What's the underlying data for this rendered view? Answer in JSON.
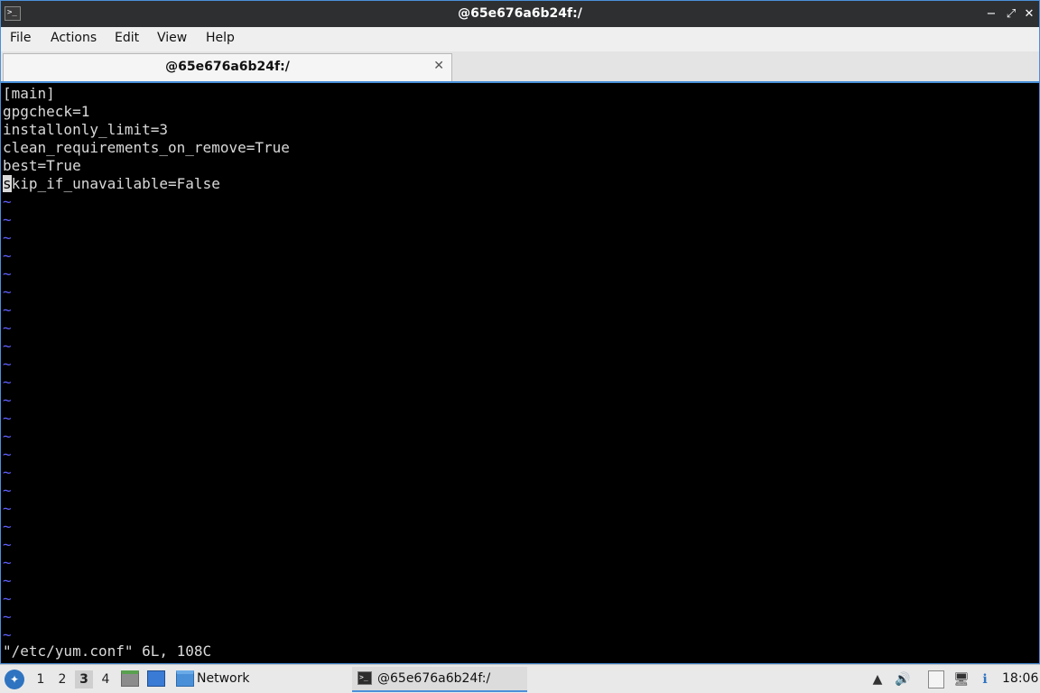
{
  "window": {
    "title": "@65e676a6b24f:/",
    "app_icon_glyph": ">_",
    "minimize_glyph": "−",
    "maximize_glyph": "⤢",
    "close_glyph": "✕"
  },
  "menubar": {
    "items": [
      "File",
      "Actions",
      "Edit",
      "View",
      "Help"
    ]
  },
  "tabs": [
    {
      "label": "@65e676a6b24f:/",
      "close_glyph": "✕",
      "active": true
    }
  ],
  "terminal": {
    "lines": [
      "[main]",
      "gpgcheck=1",
      "installonly_limit=3",
      "clean_requirements_on_remove=True",
      "best=True",
      "skip_if_unavailable=False"
    ],
    "cursor_line_first_char": "s",
    "cursor_line_rest": "kip_if_unavailable=False",
    "tilde": "~",
    "status_line": "\"/etc/yum.conf\" 6L, 108C",
    "colors": {
      "background": "#000000",
      "text": "#d9d9d9",
      "tilde": "#5f5fff"
    }
  },
  "taskbar": {
    "workspaces": [
      "1",
      "2",
      "3",
      "4"
    ],
    "active_workspace": "3",
    "launchers": [
      {
        "icon": "file-manager-icon"
      },
      {
        "icon": "show-desktop-icon"
      }
    ],
    "network_label": "Network",
    "task": {
      "label": "@65e676a6b24f:/",
      "icon": "terminal-icon"
    },
    "tray_icons": [
      "tray-up-arrow-icon",
      "volume-icon",
      "clipboard-icon",
      "network-status-icon",
      "update-notifier-icon"
    ],
    "clock": "18:06"
  }
}
